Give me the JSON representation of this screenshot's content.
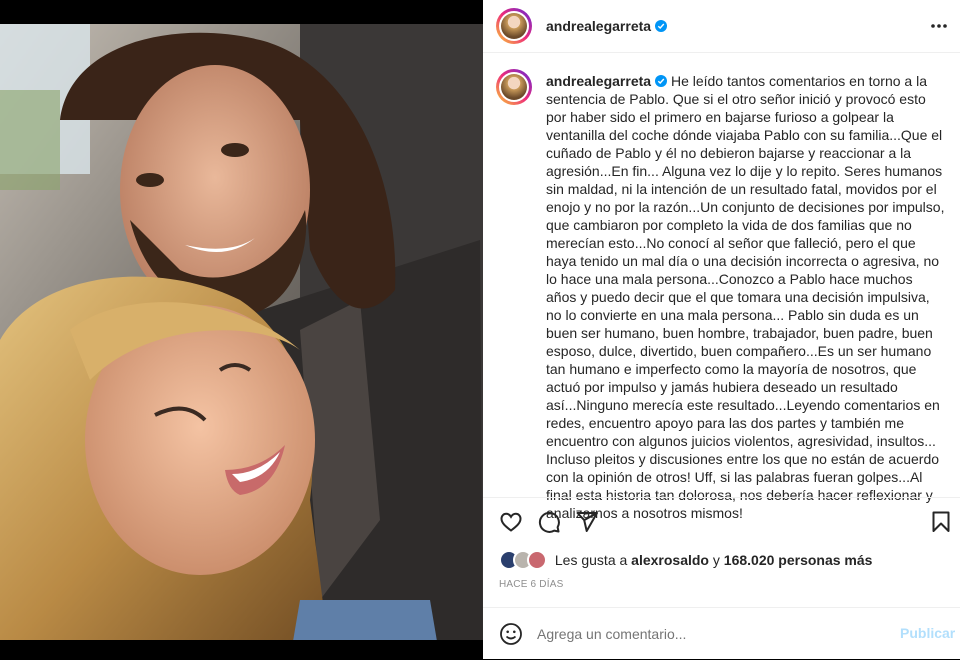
{
  "post": {
    "username": "andrealegarreta",
    "verified": true,
    "caption": "He leído tantos comentarios en torno a la sentencia de Pablo. Que si el otro señor inició y provocó esto por haber sido el primero en bajarse furioso a golpear la ventanilla del coche dónde viajaba Pablo con su familia...Que el cuñado de Pablo y él no debieron bajarse y reaccionar a la agresión...En fin... Alguna vez lo dije y lo repito. Seres humanos sin maldad, ni la intención de un resultado fatal, movidos por el enojo y no por la razón...Un conjunto de decisiones por impulso, que cambiaron por completo la vida de dos familias que no merecían esto...No conocí al señor que falleció, pero el que haya tenido un mal día o una decisión incorrecta o agresiva, no lo hace una mala persona...Conozco a Pablo hace muchos años y puedo decir que el que tomara una decisión impulsiva, no lo convierte en una mala persona... Pablo sin duda es un buen ser humano, buen hombre, trabajador, buen padre, buen esposo, dulce, divertido, buen compañero...Es un ser humano tan humano e imperfecto como la mayoría de nosotros, que actuó por impulso y jamás hubiera deseado un resultado así...Ninguno merecía este resultado...Leyendo comentarios en redes, encuentro apoyo para las dos partes y también me encuentro con algunos juicios violentos, agresividad, insultos... Incluso pleitos y discusiones entre los que no están de acuerdo con la opinión de otros! Uff, si las palabras fueran golpes...Al final esta historia tan dolorosa, nos debería hacer reflexionar y analizarnos a nosotros mismos!",
    "more_icon": "ellipsis-horizontal-icon"
  },
  "likes": {
    "prefix": "Les gusta a",
    "user": "alexrosaldo",
    "connector": "y",
    "count_text": "168.020 personas más"
  },
  "timestamp": "HACE 6 DÍAS",
  "comment": {
    "placeholder": "Agrega un comentario...",
    "publish_label": "Publicar"
  },
  "icons": {
    "like": "heart-icon",
    "comment": "comment-bubble-icon",
    "share": "paper-plane-icon",
    "save": "bookmark-icon",
    "emoji": "smiley-icon"
  },
  "colors": {
    "accent": "#0095f6",
    "publish_disabled": "#b2dffc",
    "muted": "#8e8e8e",
    "border": "#efefef"
  }
}
